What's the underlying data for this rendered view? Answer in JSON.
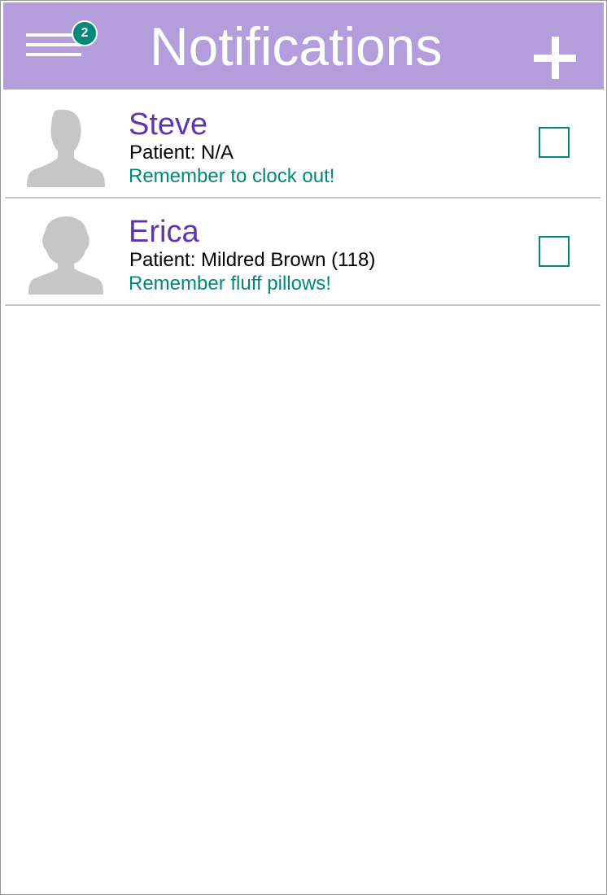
{
  "header": {
    "title": "Notifications",
    "badge_count": "2",
    "menu_icon": "hamburger-menu-icon",
    "add_icon": "plus-icon",
    "background_color": "#b39ddb"
  },
  "notifications": [
    {
      "name": "Steve",
      "patient": "Patient: N/A",
      "message": "Remember to clock out!",
      "avatar_icon": "male-avatar-icon",
      "checked": false
    },
    {
      "name": "Erica",
      "patient": "Patient: Mildred Brown (118)",
      "message": "Remember fluff pillows!",
      "avatar_icon": "female-avatar-icon",
      "checked": false
    }
  ],
  "colors": {
    "name": "#5e35b1",
    "message": "#00897b",
    "checkbox": "#00897b",
    "badge": "#00897b"
  }
}
